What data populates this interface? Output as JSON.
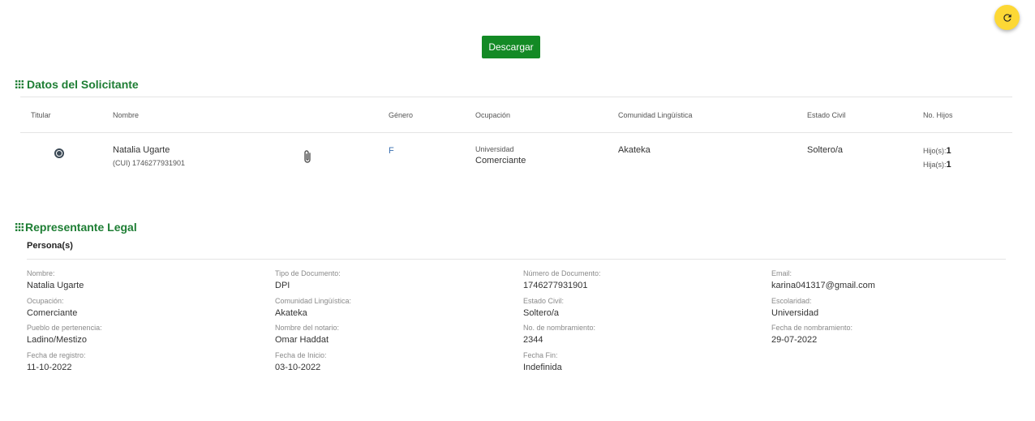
{
  "toolbar": {
    "download_label": "Descargar"
  },
  "applicant": {
    "title": "Datos del Solicitante",
    "headers": {
      "titular": "Titular",
      "name": "Nombre",
      "gender": "Género",
      "occupation": "Ocupación",
      "linguistic_community": "Comunidad Lingüística",
      "civil_status": "Estado Civil",
      "children": "No. Hijos"
    },
    "row": {
      "name": "Natalia Ugarte",
      "cui": "(CUI) 1746277931901",
      "gender": "F",
      "education": "Universidad",
      "occupation": "Comerciante",
      "linguistic_community": "Akateka",
      "civil_status": "Soltero/a",
      "sons_label": "Hijo(s):",
      "sons_value": "1",
      "daughters_label": "Hija(s):",
      "daughters_value": "1"
    }
  },
  "representative": {
    "title": "Representante Legal",
    "subtitle": "Persona(s)",
    "fields": [
      {
        "label": "Nombre:",
        "value": "Natalia Ugarte"
      },
      {
        "label": "Tipo de Documento:",
        "value": "DPI"
      },
      {
        "label": "Número de Documento:",
        "value": "1746277931901"
      },
      {
        "label": "Email:",
        "value": "karina041317@gmail.com"
      },
      {
        "label": "Ocupación:",
        "value": "Comerciante"
      },
      {
        "label": "Comunidad Lingüística:",
        "value": "Akateka"
      },
      {
        "label": "Estado Civil:",
        "value": "Soltero/a"
      },
      {
        "label": "Escolaridad:",
        "value": "Universidad"
      },
      {
        "label": "Pueblo de pertenencia:",
        "value": "Ladino/Mestizo"
      },
      {
        "label": "Nombre del notario:",
        "value": "Omar Haddat"
      },
      {
        "label": "No. de nombramiento:",
        "value": "2344"
      },
      {
        "label": "Fecha de nombramiento:",
        "value": "29-07-2022"
      },
      {
        "label": "Fecha de registro:",
        "value": "11-10-2022"
      },
      {
        "label": "Fecha de Inicio:",
        "value": "03-10-2022"
      },
      {
        "label": "Fecha Fin:",
        "value": "Indefinida"
      }
    ]
  },
  "colors": {
    "accent_green": "#1e7e34",
    "button_green": "#138a25",
    "fab_yellow": "#fdd835"
  },
  "icons": {
    "refresh": "refresh-icon",
    "grid": "grid-icon",
    "attachment": "paperclip-icon",
    "radio": "radio-selected-icon"
  }
}
